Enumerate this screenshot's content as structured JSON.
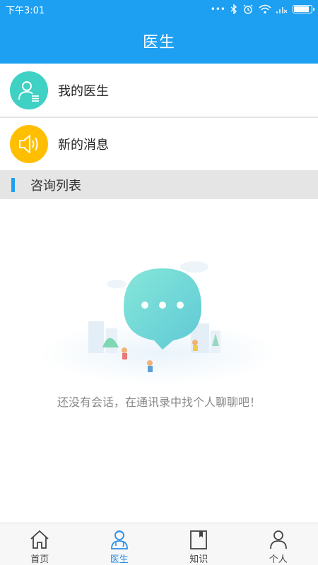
{
  "status_bar": {
    "time": "下午3:01",
    "dots": "•••",
    "battery_level": 0.9
  },
  "header": {
    "title": "医生"
  },
  "menu": {
    "my_doctor": "我的医生",
    "new_messages": "新的消息"
  },
  "section": {
    "title": "咨询列表"
  },
  "empty_state": {
    "message": "还没有会话，在通讯录中找个人聊聊吧！"
  },
  "tabs": [
    {
      "label": "首页",
      "icon": "home-icon",
      "active": false
    },
    {
      "label": "医生",
      "icon": "doctor-icon",
      "active": true
    },
    {
      "label": "知识",
      "icon": "book-icon",
      "active": false
    },
    {
      "label": "个人",
      "icon": "person-icon",
      "active": false
    }
  ],
  "colors": {
    "primary": "#1ea0f2",
    "teal": "#3ed1c4",
    "yellow": "#ffbf00",
    "tab_active": "#2a8ee8"
  }
}
